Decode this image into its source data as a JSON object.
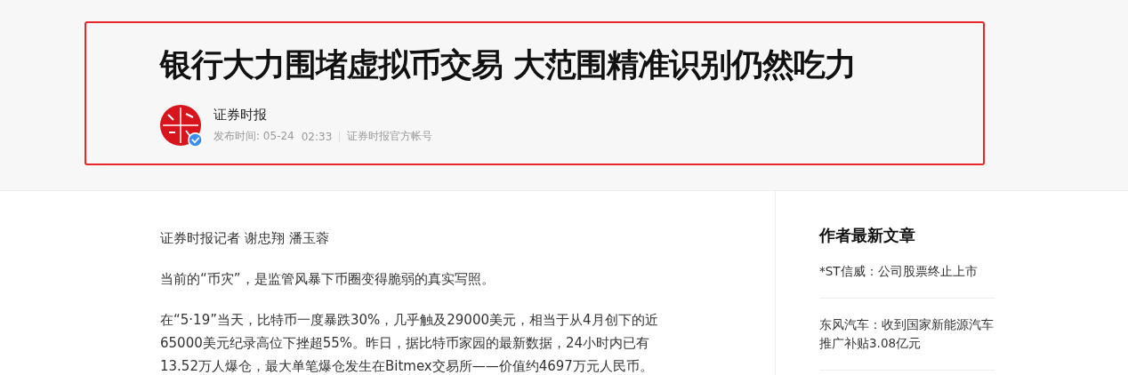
{
  "article": {
    "title": "银行大力围堵虚拟币交易 大范围精准识别仍然吃力",
    "source": {
      "name": "证券时报",
      "publish_label": "发布时间: 05-24",
      "time": "02:33",
      "account_type": "证券时报官方帐号",
      "verified": true
    }
  },
  "body": {
    "paragraphs": [
      "证券时报记者 谢忠翔 潘玉蓉",
      "当前的“币灾”，是监管风暴下币圈变得脆弱的真实写照。",
      "在“5·19”当天，比特币一度暴跌30%，几乎触及29000美元，相当于从4月创下的近65000美元纪录高位下挫超55%。昨日，据比特币家园的最新数据，24小时内已有13.52万人爆仓，最大单笔爆仓发生在Bitmex交易所——价值约4697万元人民币。"
    ]
  },
  "sidebar": {
    "title": "作者最新文章",
    "items": [
      "*ST信威：公司股票终止上市",
      "东风汽车：收到国家新能源汽车推广补贴3.08亿元"
    ]
  }
}
